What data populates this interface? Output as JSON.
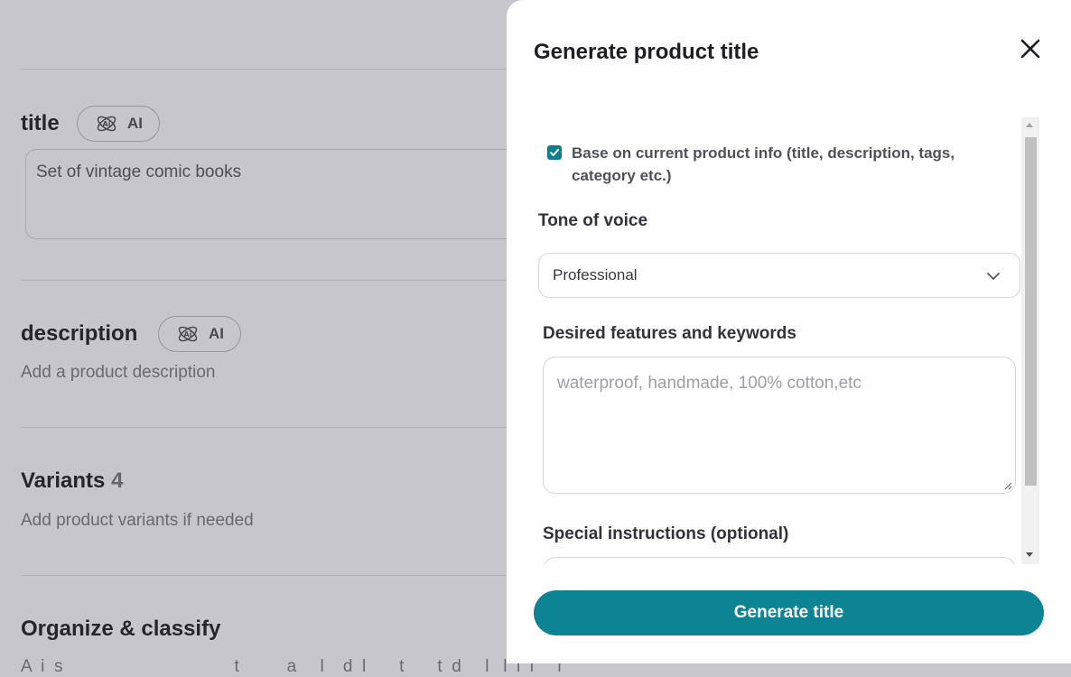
{
  "background": {
    "title_section": {
      "heading": "title",
      "value": "Set of vintage comic books"
    },
    "description_section": {
      "heading": "description",
      "subtitle": "Add a product description"
    },
    "variants_section": {
      "heading": "Variants",
      "count": "4",
      "subtitle": "Add product variants if needed"
    },
    "organize_section": {
      "heading": "Organize & classify",
      "subtitle": "A  i  s                                    t          a     l    d  l       t       t  d     l   l  i  i     i"
    },
    "ai_badge_label": "AI"
  },
  "modal": {
    "title": "Generate product title",
    "base_on_current": {
      "label": "Base on current product info (title, description, tags, category etc.)",
      "checked": true
    },
    "tone": {
      "label": "Tone of voice",
      "selected": "Professional"
    },
    "keywords": {
      "label": "Desired features and keywords",
      "placeholder": "waterproof, handmade, 100% cotton,etc"
    },
    "special": {
      "label": "Special instructions (optional)"
    },
    "generate_label": "Generate title"
  },
  "colors": {
    "accent": "#0d8494",
    "overlay": "#c7c6cc"
  },
  "icons": {
    "close": "close-icon",
    "ai": "ai-atom-icon",
    "chevron": "chevron-down-icon",
    "check": "check-icon"
  }
}
